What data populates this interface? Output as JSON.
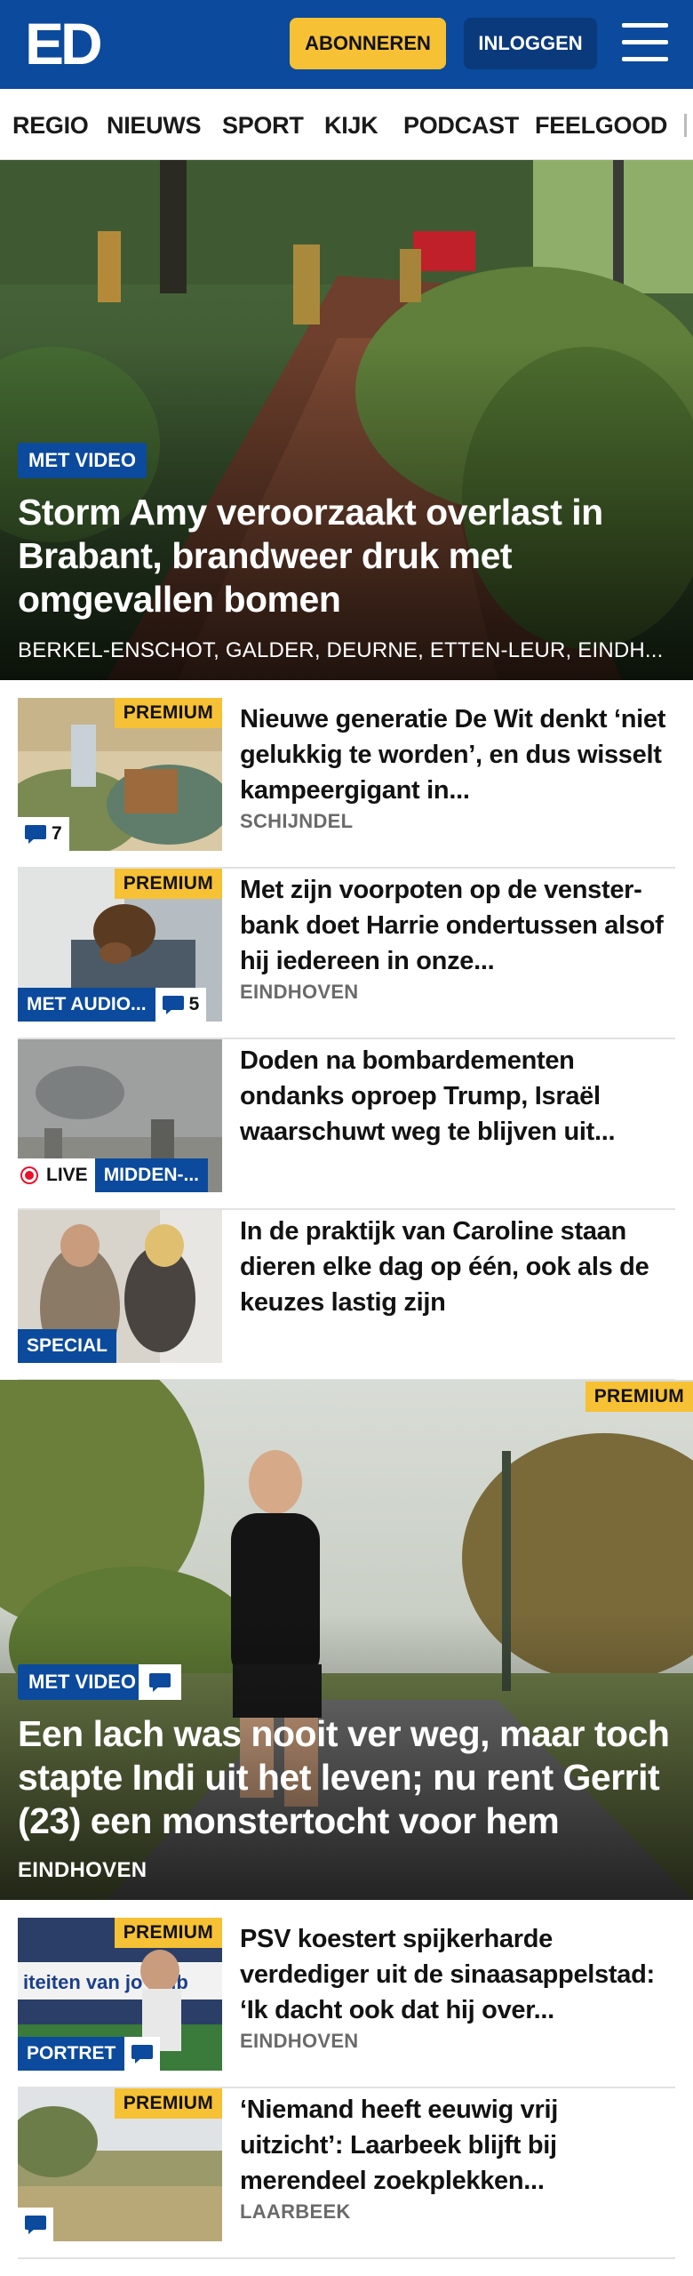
{
  "header": {
    "logo_text": "ED",
    "subscribe_label": "ABONNEREN",
    "login_label": "INLOGGEN",
    "menu_icon": "hamburger-menu-icon",
    "brand_color": "#0b4a9c",
    "accent_color": "#f6c134"
  },
  "nav": {
    "items": [
      "REGIO",
      "NIEUWS",
      "SPORT",
      "KIJK",
      "PODCAST",
      "FEELGOOD"
    ]
  },
  "hero": {
    "badge": "MET VIDEO",
    "title": "Storm Amy veroorzaakt overlast in Brabant, brandweer druk met omgevallen bomen",
    "locations": "BERKEL-ENSCHOT, GALDER, DEURNE, ETTEN-LEUR, EINDH..."
  },
  "articles": [
    {
      "premium": "PREMIUM",
      "title": "Nieuwe generatie De Wit denkt ‘niet gelukkig te worden’, en dus wisselt kampeergigant in...",
      "location": "SCHIJNDEL",
      "comments": "7"
    },
    {
      "premium": "PREMIUM",
      "title": "Met zijn voorpoten op de venster­bank doet Harrie ondertussen alsof hij iedereen in onze...",
      "location": "EINDHOVEN",
      "badge": "MET AUDIO...",
      "comments": "5"
    },
    {
      "title": "Doden na bombardementen ondanks oproep Trump, Israël waarschuwt weg te blijven uit...",
      "live_label": "LIVE",
      "badge": "MIDDEN-..."
    },
    {
      "title": "In de praktijk van Caroline staan dieren elke dag op één, ook als de keuzes lastig zijn",
      "badge": "SPECIAL"
    }
  ],
  "feature": {
    "premium": "PREMIUM",
    "badge": "MET VIDEO",
    "title": "Een lach was nooit ver weg, maar toch stapte Indi uit het leven; nu rent Gerrit (23) een monstertocht voor hem",
    "location": "EINDHOVEN"
  },
  "articles_2": [
    {
      "premium": "PREMIUM",
      "title": "PSV koestert spijkerharde verdediger uit de sinaasappel­stad: ‘Ik dacht ook dat hij over...",
      "location": "EINDHOVEN",
      "badge": "PORTRET",
      "banner_text": "iteiten van jo    club"
    },
    {
      "premium": "PREMIUM",
      "title": "‘Niemand heeft eeuwig vrij uitzicht’: Laarbeek blijft bij merendeel zoekplekken...",
      "location": "LAARBEEK"
    }
  ]
}
